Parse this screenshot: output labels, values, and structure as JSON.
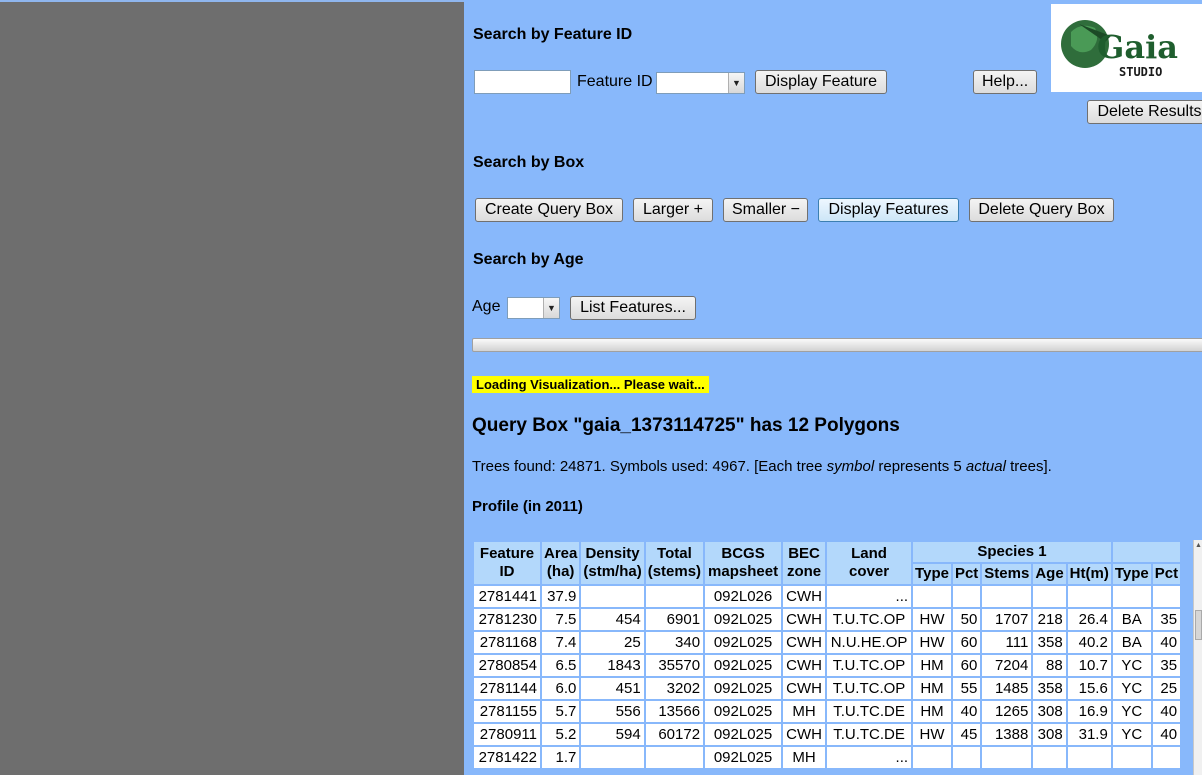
{
  "feature_search": {
    "heading": "Search by Feature ID",
    "input_value": "",
    "feature_id_label": "Feature ID",
    "feature_select_value": "",
    "display_button": "Display Feature",
    "help_button": "Help...",
    "delete_results_button": "Delete Results"
  },
  "logo": {
    "wordmark": "Gaia",
    "sub": "STUDIO"
  },
  "box_search": {
    "heading": "Search by Box",
    "create_button": "Create Query Box",
    "larger_button": "Larger +",
    "smaller_button": "Smaller −",
    "display_button": "Display Features",
    "delete_button": "Delete Query Box"
  },
  "age_search": {
    "heading": "Search by Age",
    "age_label": "Age",
    "age_value": "",
    "list_button": "List Features..."
  },
  "loading_text": "Loading Visualization... Please wait...",
  "query_title": "Query Box \"gaia_1373114725\" has 12 Polygons",
  "trees_line": {
    "part1": "Trees found: 24871.   Symbols used: 4967.   [Each tree ",
    "em1": "symbol",
    "part2": " represents 5 ",
    "em2": "actual",
    "part3": " trees]."
  },
  "profile_title": "Profile (in 2011)",
  "table": {
    "headers": {
      "feature_id": "Feature ID",
      "area": "Area (ha)",
      "density": "Density (stm/ha)",
      "total": "Total (stems)",
      "bcgs": "BCGS mapsheet",
      "bec": "BEC zone",
      "land": "Land cover",
      "species1": "Species 1",
      "type": "Type",
      "pct": "Pct",
      "stems": "Stems",
      "age": "Age",
      "ht": "Ht(m)",
      "type2": "Type",
      "pct2": "Pct"
    },
    "rows": [
      [
        "2781441",
        "37.9",
        "",
        "",
        "092L026",
        "CWH",
        "...",
        "",
        "",
        "",
        "",
        "",
        "",
        ""
      ],
      [
        "2781230",
        "7.5",
        "454",
        "6901",
        "092L025",
        "CWH",
        "T.U.TC.OP",
        "HW",
        "50",
        "1707",
        "218",
        "26.4",
        "BA",
        "35"
      ],
      [
        "2781168",
        "7.4",
        "25",
        "340",
        "092L025",
        "CWH",
        "N.U.HE.OP",
        "HW",
        "60",
        "111",
        "358",
        "40.2",
        "BA",
        "40"
      ],
      [
        "2780854",
        "6.5",
        "1843",
        "35570",
        "092L025",
        "CWH",
        "T.U.TC.OP",
        "HM",
        "60",
        "7204",
        "88",
        "10.7",
        "YC",
        "35"
      ],
      [
        "2781144",
        "6.0",
        "451",
        "3202",
        "092L025",
        "CWH",
        "T.U.TC.OP",
        "HM",
        "55",
        "1485",
        "358",
        "15.6",
        "YC",
        "25"
      ],
      [
        "2781155",
        "5.7",
        "556",
        "13566",
        "092L025",
        "MH",
        "T.U.TC.DE",
        "HM",
        "40",
        "1265",
        "308",
        "16.9",
        "YC",
        "40"
      ],
      [
        "2780911",
        "5.2",
        "594",
        "60172",
        "092L025",
        "CWH",
        "T.U.TC.DE",
        "HW",
        "45",
        "1388",
        "308",
        "31.9",
        "YC",
        "40"
      ],
      [
        "2781422",
        "1.7",
        "",
        "",
        "092L025",
        "MH",
        "...",
        "",
        "",
        "",
        "",
        "",
        "",
        ""
      ]
    ]
  }
}
